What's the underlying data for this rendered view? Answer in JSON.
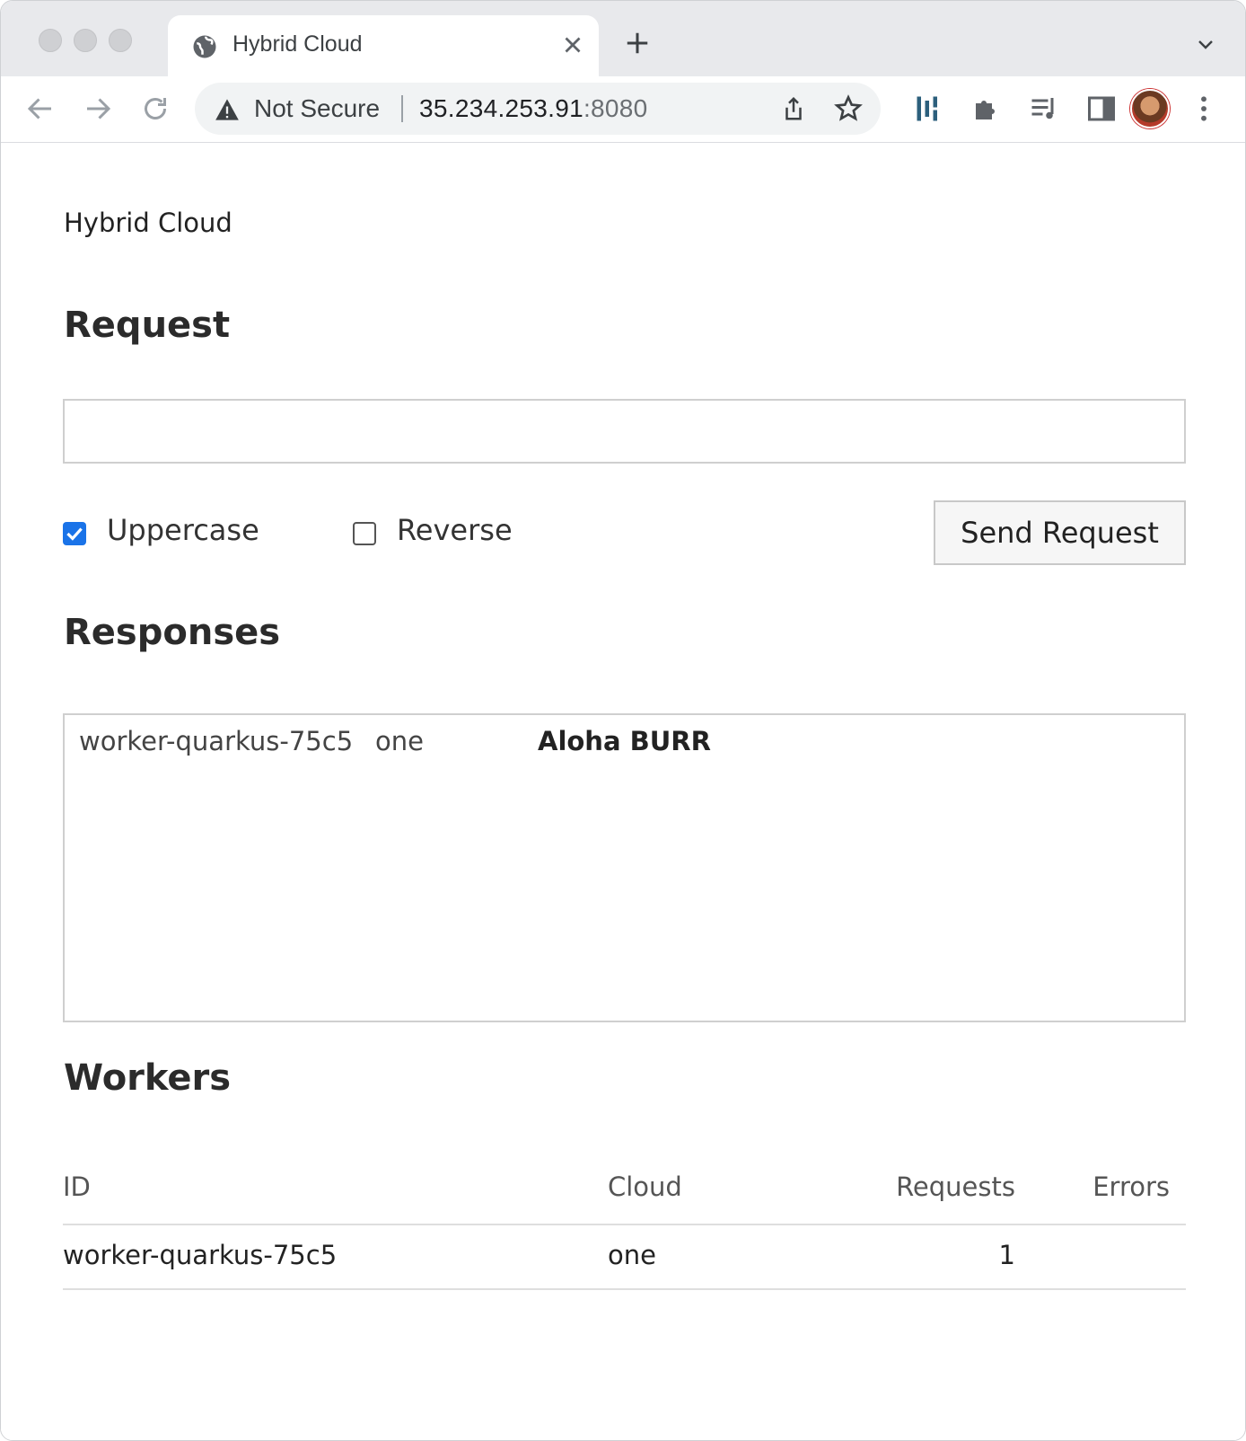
{
  "browser": {
    "tab_title": "Hybrid Cloud",
    "security_label": "Not Secure",
    "url_host": "35.234.253.91",
    "url_port": ":8080"
  },
  "page": {
    "brand": "Hybrid Cloud",
    "request_heading": "Request",
    "request_input_value": "",
    "uppercase_label": "Uppercase",
    "uppercase_checked": true,
    "reverse_label": "Reverse",
    "reverse_checked": false,
    "send_button_label": "Send Request",
    "responses_heading": "Responses",
    "responses": [
      {
        "worker": "worker-quarkus-75c5",
        "cloud": "one",
        "message": "Aloha BURR"
      }
    ],
    "workers_heading": "Workers",
    "workers_columns": [
      "ID",
      "Cloud",
      "Requests",
      "Errors"
    ],
    "workers": [
      {
        "id": "worker-quarkus-75c5",
        "cloud": "one",
        "requests": "1",
        "errors": ""
      }
    ]
  },
  "colors": {
    "accent": "#1a73e8",
    "chrome_bg": "#e8e9ec",
    "omnibox_bg": "#f1f3f4",
    "border": "#cfcfcf"
  }
}
